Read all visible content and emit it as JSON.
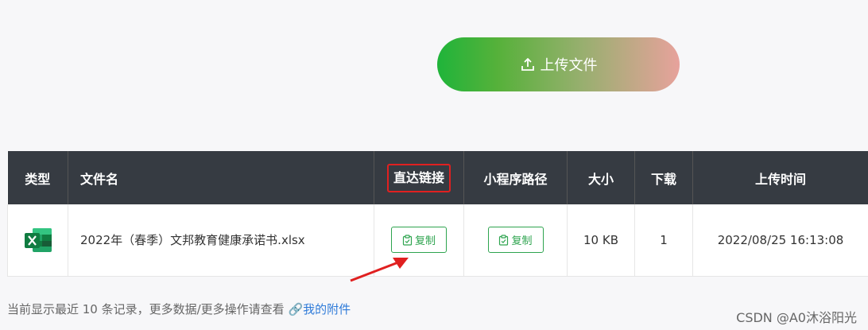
{
  "upload": {
    "label": "上传文件",
    "gradient_start": "#1fb43a",
    "gradient_end": "#e7a29c",
    "icon": "upload-icon"
  },
  "table": {
    "headers": {
      "type": "类型",
      "filename": "文件名",
      "direct_link": "直达链接",
      "mini_path": "小程序路径",
      "size": "大小",
      "downloads": "下载",
      "upload_time": "上传时间"
    },
    "header_bg": "#363b42",
    "rows": [
      {
        "type_icon": "excel-icon",
        "filename": "2022年（春季）文邦教育健康承诺书.xlsx",
        "direct_link_label": "复制",
        "mini_path_label": "复制",
        "size": "10 KB",
        "downloads": "1",
        "upload_time": "2022/08/25 16:13:08"
      }
    ]
  },
  "annotation": {
    "highlight_color": "#e02020",
    "arrow_color": "#e02020"
  },
  "footer": {
    "note": "当前显示最近 10 条记录，更多数据/更多操作请查看",
    "link_label": "我的附件",
    "link_icon": "link-icon",
    "link_color": "#2f7bd9"
  },
  "watermark": "CSDN @A0沐浴阳光"
}
